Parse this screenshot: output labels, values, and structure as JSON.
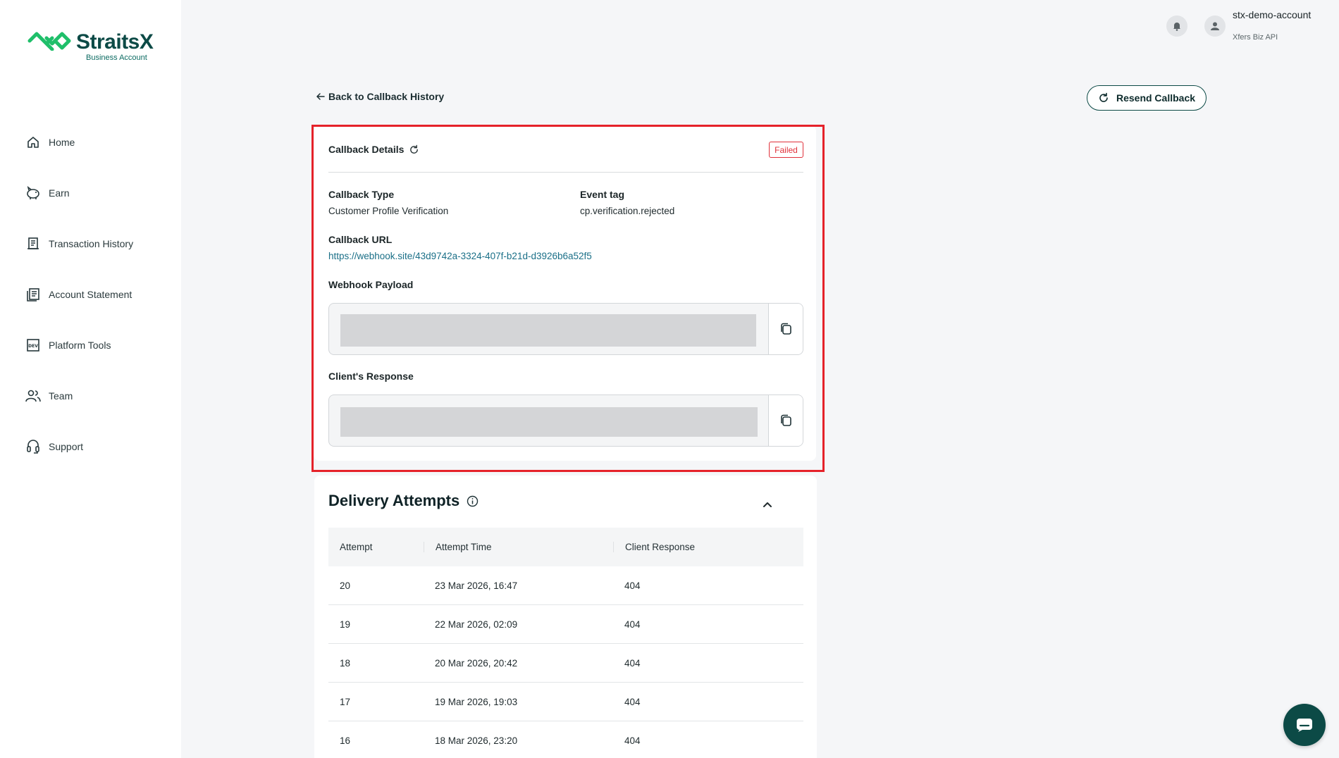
{
  "brand": {
    "name": "StraitsX",
    "subtitle": "Business Account",
    "accent": "#0c4a46",
    "logo_green": "#1fbf6a"
  },
  "sidebar": {
    "items": [
      {
        "label": "Home",
        "icon": "home-icon"
      },
      {
        "label": "Earn",
        "icon": "piggy-bank-icon"
      },
      {
        "label": "Transaction History",
        "icon": "receipt-icon"
      },
      {
        "label": "Account Statement",
        "icon": "statement-icon"
      },
      {
        "label": "Platform Tools",
        "icon": "dev-tools-icon"
      },
      {
        "label": "Team",
        "icon": "team-icon"
      },
      {
        "label": "Support",
        "icon": "headset-icon"
      }
    ]
  },
  "topbar": {
    "account_name": "stx-demo-account",
    "account_sub": "Xfers Biz API"
  },
  "page": {
    "back_label": "Back to Callback History",
    "resend_label": "Resend Callback"
  },
  "callback": {
    "title": "Callback Details",
    "status": "Failed",
    "status_color": "#e0303a",
    "type_label": "Callback Type",
    "type_value": "Customer Profile Verification",
    "event_label": "Event tag",
    "event_value": "cp.verification.rejected",
    "url_label": "Callback URL",
    "url_value": "https://webhook.site/43d9742a-3324-407f-b21d-d3926b6a52f5",
    "payload_label": "Webhook Payload",
    "response_label": "Client's Response"
  },
  "delivery": {
    "title": "Delivery Attempts",
    "columns": [
      "Attempt",
      "Attempt Time",
      "Client Response"
    ],
    "rows": [
      {
        "attempt": "20",
        "time": "23 Mar 2026, 16:47",
        "response": "404"
      },
      {
        "attempt": "19",
        "time": "22 Mar 2026, 02:09",
        "response": "404"
      },
      {
        "attempt": "18",
        "time": "20 Mar 2026, 20:42",
        "response": "404"
      },
      {
        "attempt": "17",
        "time": "19 Mar 2026, 19:03",
        "response": "404"
      },
      {
        "attempt": "16",
        "time": "18 Mar 2026, 23:20",
        "response": "404"
      }
    ]
  }
}
